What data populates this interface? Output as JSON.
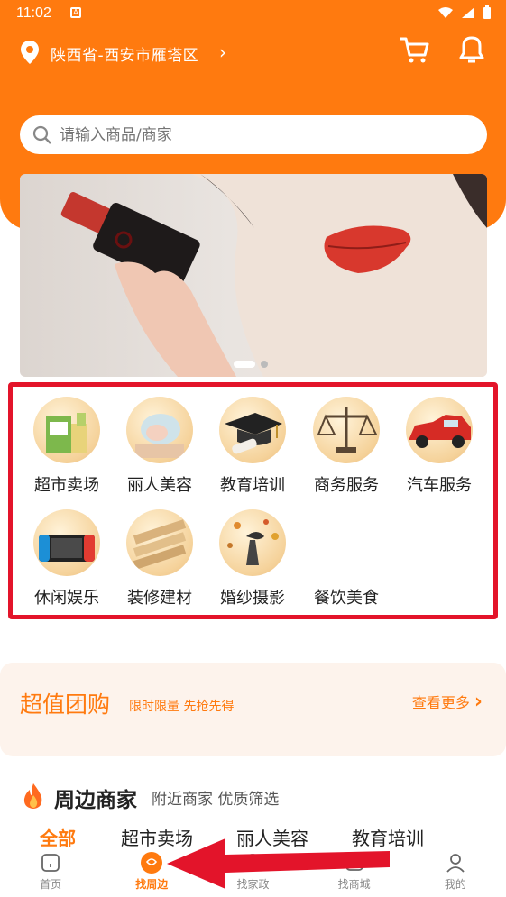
{
  "status_bar": {
    "time": "11:02"
  },
  "header": {
    "location": "陕西省-西安市雁塔区"
  },
  "search": {
    "placeholder": "请输入商品/商家"
  },
  "categories": [
    {
      "label": "超市卖场",
      "icon": "supermarket-icon"
    },
    {
      "label": "丽人美容",
      "icon": "beauty-icon"
    },
    {
      "label": "教育培训",
      "icon": "graduation-cap-icon"
    },
    {
      "label": "商务服务",
      "icon": "scales-icon"
    },
    {
      "label": "汽车服务",
      "icon": "car-icon"
    },
    {
      "label": "休闲娱乐",
      "icon": "game-console-icon"
    },
    {
      "label": "装修建材",
      "icon": "wood-planks-icon"
    },
    {
      "label": "婚纱摄影",
      "icon": "wedding-photo-icon"
    },
    {
      "label": "餐饮美食",
      "icon": "food-icon"
    }
  ],
  "group_buy": {
    "title": "超值团购",
    "subtitle": "限时限量 先抢先得",
    "more": "查看更多"
  },
  "nearby": {
    "title": "周边商家",
    "subtitle": "附近商家 优质筛选",
    "tabs": [
      "全部",
      "超市卖场",
      "丽人美容",
      "教育培训"
    ]
  },
  "tabbar": [
    {
      "label": "首页",
      "icon": "home-icon"
    },
    {
      "label": "找周边",
      "icon": "nearby-icon"
    },
    {
      "label": "找家政",
      "icon": "housekeeping-icon"
    },
    {
      "label": "找商城",
      "icon": "mall-icon"
    },
    {
      "label": "我的",
      "icon": "profile-icon"
    }
  ],
  "colors": {
    "brand": "#ff7a0f",
    "highlight_box": "#e3142a",
    "annotation_arrow": "#e3142a"
  }
}
